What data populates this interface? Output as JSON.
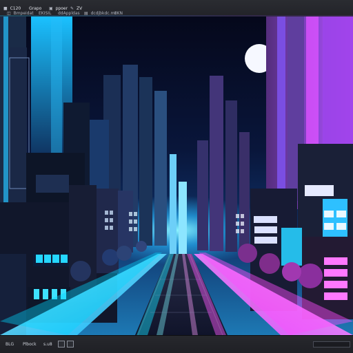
{
  "menu": {
    "items": [
      {
        "label": "C120",
        "icon": "app-icon"
      },
      {
        "label": "Grapo",
        "icon": ""
      },
      {
        "label": "ppoer",
        "icon": "image-icon"
      },
      {
        "label": "ZV",
        "icon": "brush-icon"
      }
    ],
    "sub_items": [
      {
        "label": "Bmpeidat",
        "icon": "layer-icon"
      },
      {
        "label": "EKISIL",
        "icon": ""
      },
      {
        "label": "ddAppldas",
        "icon": ""
      },
      {
        "label": "dcdjbkdc.mt",
        "icon": "folder-icon"
      },
      {
        "label": "IIKN",
        "icon": ""
      }
    ]
  },
  "status": {
    "items": [
      {
        "label": "BLG",
        "icon": ""
      },
      {
        "label": "Plbock",
        "icon": ""
      },
      {
        "label": "s.u8",
        "icon": ""
      }
    ]
  },
  "palette": {
    "cyan": "#27d5ff",
    "magenta": "#e548ff",
    "bg_top": "#05081b",
    "bg_bottom": "#0f3f75"
  }
}
